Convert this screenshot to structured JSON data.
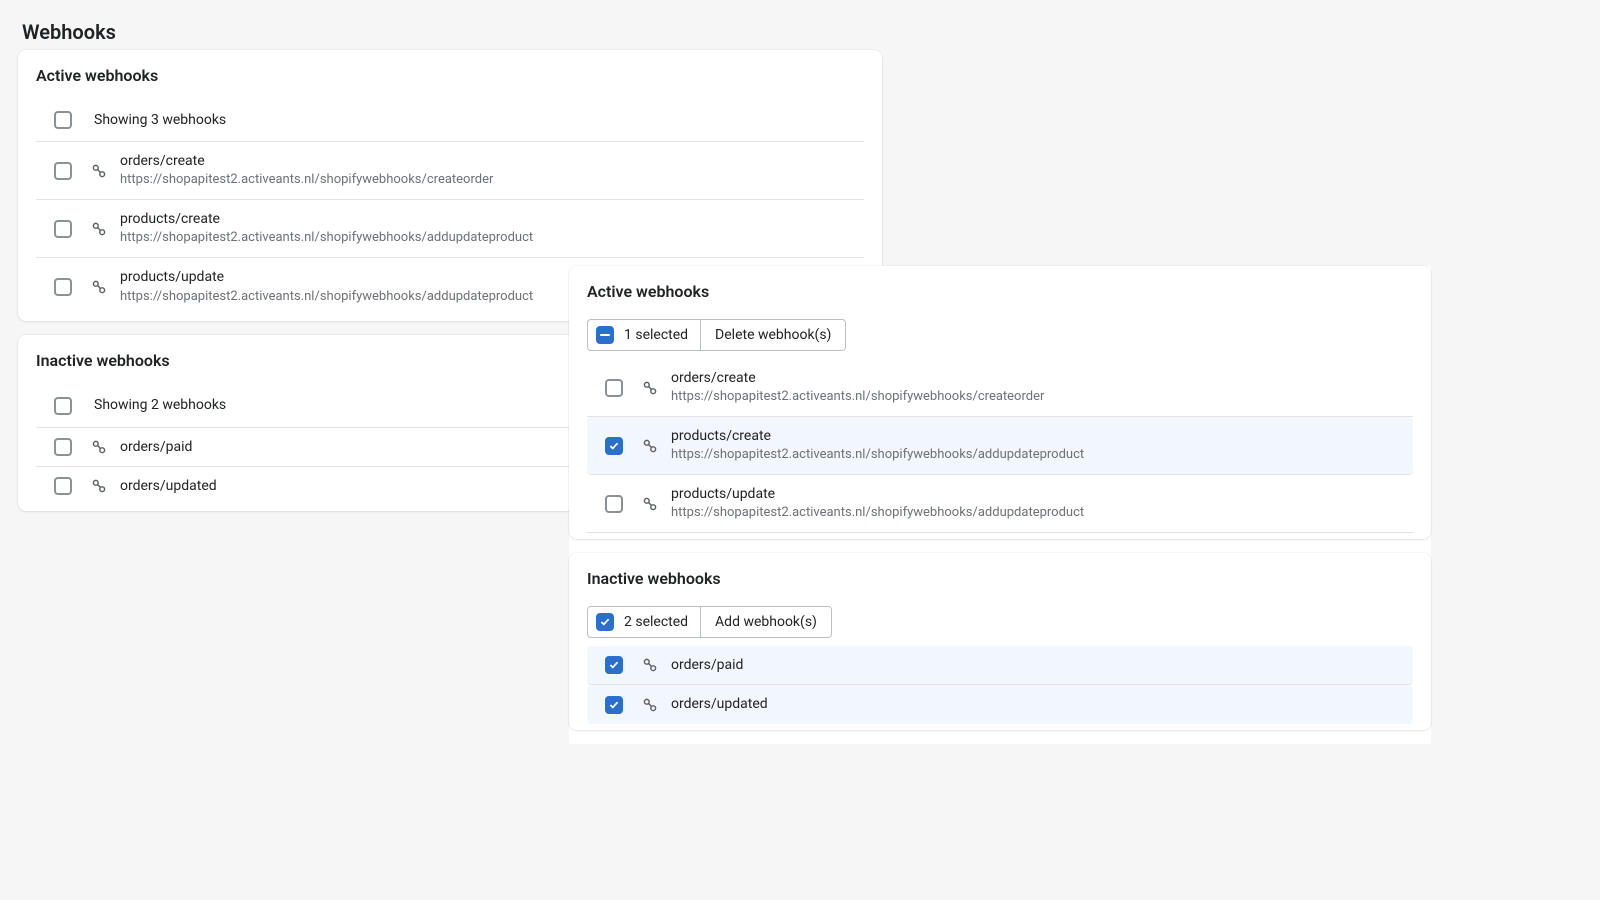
{
  "pageTitle": "Webhooks",
  "left": {
    "active": {
      "title": "Active webhooks",
      "headerText": "Showing 3 webhooks",
      "rows": [
        {
          "topic": "orders/create",
          "url": "https://shopapitest2.activeants.nl/shopifywebhooks/createorder"
        },
        {
          "topic": "products/create",
          "url": "https://shopapitest2.activeants.nl/shopifywebhooks/addupdateproduct"
        },
        {
          "topic": "products/update",
          "url": "https://shopapitest2.activeants.nl/shopifywebhooks/addupdateproduct"
        }
      ]
    },
    "inactive": {
      "title": "Inactive webhooks",
      "headerText": "Showing 2 webhooks",
      "rows": [
        {
          "topic": "orders/paid"
        },
        {
          "topic": "orders/updated"
        }
      ]
    }
  },
  "right": {
    "active": {
      "title": "Active webhooks",
      "selectedText": "1 selected",
      "actionLabel": "Delete webhook(s)",
      "selectState": "indeterminate",
      "rows": [
        {
          "topic": "orders/create",
          "url": "https://shopapitest2.activeants.nl/shopifywebhooks/createorder",
          "checked": false
        },
        {
          "topic": "products/create",
          "url": "https://shopapitest2.activeants.nl/shopifywebhooks/addupdateproduct",
          "checked": true
        },
        {
          "topic": "products/update",
          "url": "https://shopapitest2.activeants.nl/shopifywebhooks/addupdateproduct",
          "checked": false
        }
      ]
    },
    "inactive": {
      "title": "Inactive webhooks",
      "selectedText": "2 selected",
      "actionLabel": "Add webhook(s)",
      "selectState": "checked",
      "rows": [
        {
          "topic": "orders/paid",
          "checked": true
        },
        {
          "topic": "orders/updated",
          "checked": true
        }
      ]
    }
  }
}
